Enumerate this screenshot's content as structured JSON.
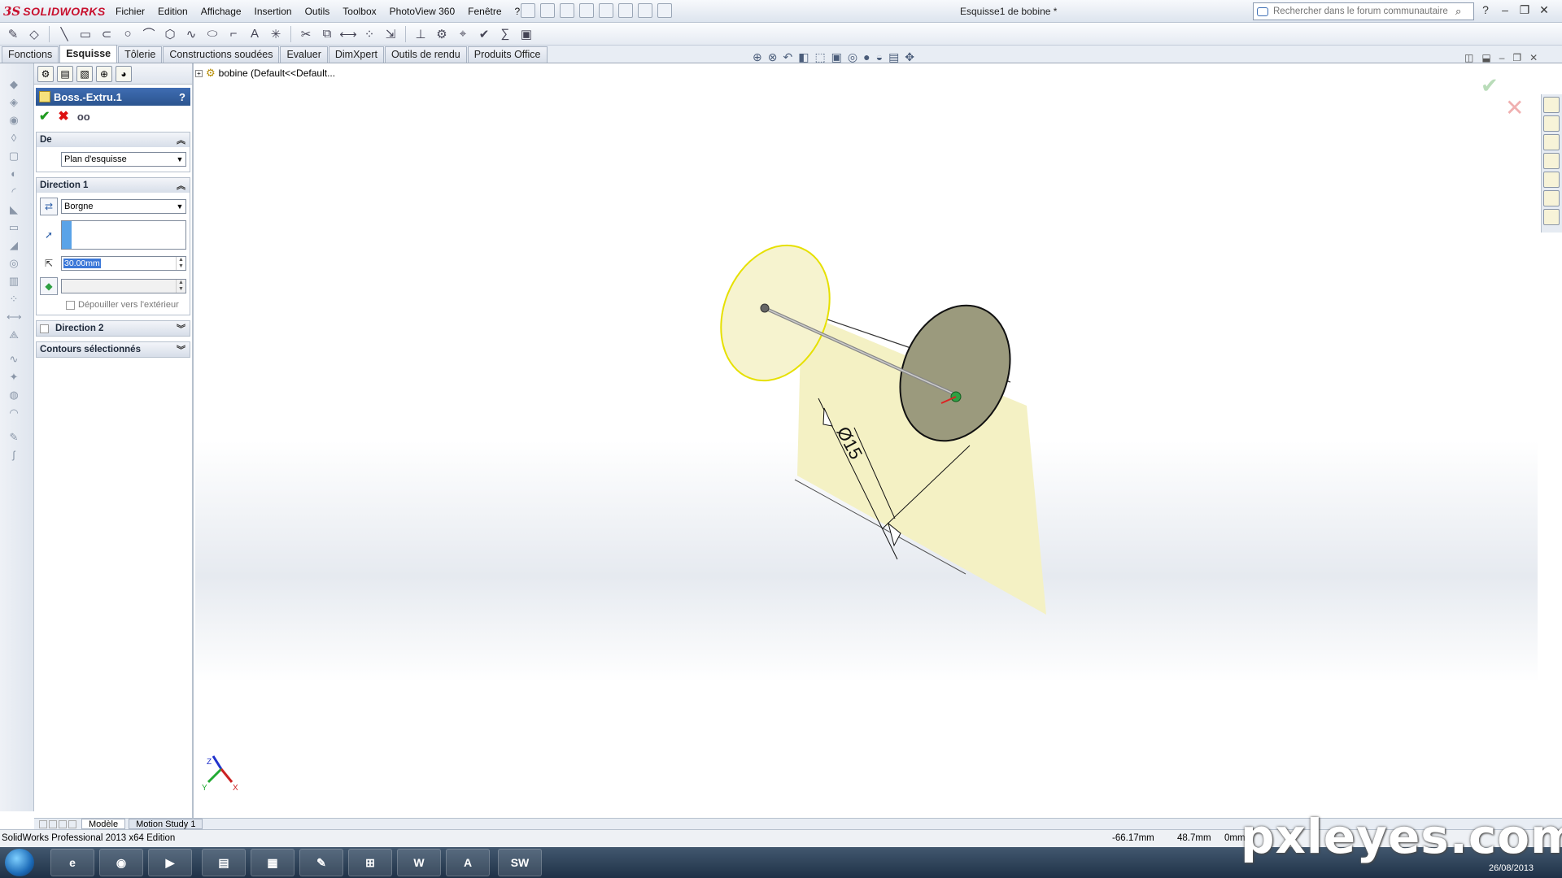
{
  "app": {
    "logo_ds": "3S",
    "logo_name": "SOLIDWORKS",
    "window_title": "Esquisse1 de bobine *",
    "menus": [
      "Fichier",
      "Edition",
      "Affichage",
      "Insertion",
      "Outils",
      "Toolbox",
      "PhotoView 360",
      "Fenêtre",
      "?"
    ],
    "search_placeholder": "Rechercher dans le forum communautaire"
  },
  "command_tabs": [
    {
      "label": "Fonctions",
      "active": false
    },
    {
      "label": "Esquisse",
      "active": true
    },
    {
      "label": "Tôlerie",
      "active": false
    },
    {
      "label": "Constructions soudées",
      "active": false
    },
    {
      "label": "Evaluer",
      "active": false
    },
    {
      "label": "DimXpert",
      "active": false
    },
    {
      "label": "Outils de rendu",
      "active": false
    },
    {
      "label": "Produits Office",
      "active": false
    }
  ],
  "property_manager": {
    "title": "Boss.-Extru.1",
    "help": "?",
    "ok_glyph": "✔",
    "cancel_glyph": "✖",
    "from": {
      "header": "De",
      "value": "Plan d'esquisse"
    },
    "direction1": {
      "header": "Direction 1",
      "end_condition": "Borgne",
      "depth": "30.00mm",
      "draft_label": "Dépouiller vers l'extérieur"
    },
    "direction2": {
      "header": "Direction 2"
    },
    "contours": {
      "header": "Contours sélectionnés"
    }
  },
  "feature_tree": {
    "item": "bobine  (Default<<Default..."
  },
  "viewport": {
    "dimension_label": "Ø15",
    "axis_z": "Z",
    "axis_y": "Y",
    "axis_x": "X"
  },
  "bottom_tabs": [
    {
      "label": "Modèle",
      "active": true
    },
    {
      "label": "Motion Study 1",
      "active": false
    }
  ],
  "status": {
    "app_name": "SolidWorks Professional 2013 x64 Edition",
    "x": "-66.17mm",
    "y": "48.7mm",
    "z": "0mm"
  },
  "taskbar": {
    "date": "26/08/2013"
  },
  "watermark": "pxleyes.com",
  "colors": {
    "accent": "#2b548f",
    "cylinder_body": "#f4f1c4",
    "cylinder_end": "#9b9a7d",
    "highlight": "#e6e000"
  }
}
